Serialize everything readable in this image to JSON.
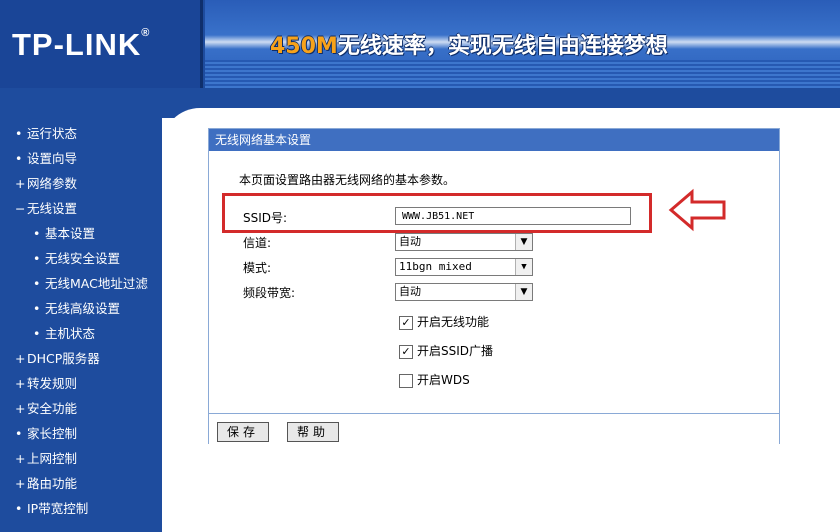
{
  "header": {
    "logo": "TP-LINK",
    "logo_mark": "®",
    "slogan_speed": "450M",
    "slogan_text": "无线速率，实现无线自由连接梦想"
  },
  "sidebar": {
    "items": [
      {
        "bullet": "•",
        "label": "运行状态"
      },
      {
        "bullet": "•",
        "label": "设置向导"
      },
      {
        "bullet": "+",
        "label": "网络参数"
      },
      {
        "bullet": "−",
        "label": "无线设置"
      },
      {
        "bullet": "•",
        "label": "基本设置"
      },
      {
        "bullet": "•",
        "label": "无线安全设置"
      },
      {
        "bullet": "•",
        "label": "无线MAC地址过滤"
      },
      {
        "bullet": "•",
        "label": "无线高级设置"
      },
      {
        "bullet": "•",
        "label": "主机状态"
      },
      {
        "bullet": "+",
        "label": "DHCP服务器"
      },
      {
        "bullet": "+",
        "label": "转发规则"
      },
      {
        "bullet": "+",
        "label": "安全功能"
      },
      {
        "bullet": "•",
        "label": "家长控制"
      },
      {
        "bullet": "+",
        "label": "上网控制"
      },
      {
        "bullet": "+",
        "label": "路由功能"
      },
      {
        "bullet": "•",
        "label": "IP带宽控制"
      }
    ]
  },
  "panel": {
    "title": "无线网络基本设置",
    "description": "本页面设置路由器无线网络的基本参数。",
    "ssid_label": "SSID号:",
    "ssid_value": "WWW.JB51.NET",
    "channel_label": "信道:",
    "channel_value": "自动",
    "mode_label": "模式:",
    "mode_value": "11bgn mixed",
    "bandwidth_label": "频段带宽:",
    "bandwidth_value": "自动",
    "select_arrow": "▼",
    "checkboxes": [
      {
        "label": "开启无线功能",
        "checked": true,
        "mark": "✓"
      },
      {
        "label": "开启SSID广播",
        "checked": true,
        "mark": "✓"
      },
      {
        "label": "开启WDS",
        "checked": false,
        "mark": ""
      }
    ],
    "save_button": "保存",
    "help_button": "帮助"
  },
  "colors": {
    "brand_blue": "#1e4c9e",
    "panel_title": "#3f6fc1",
    "highlight_red": "#d32a2a",
    "slogan_orange": "#f7a21a"
  }
}
